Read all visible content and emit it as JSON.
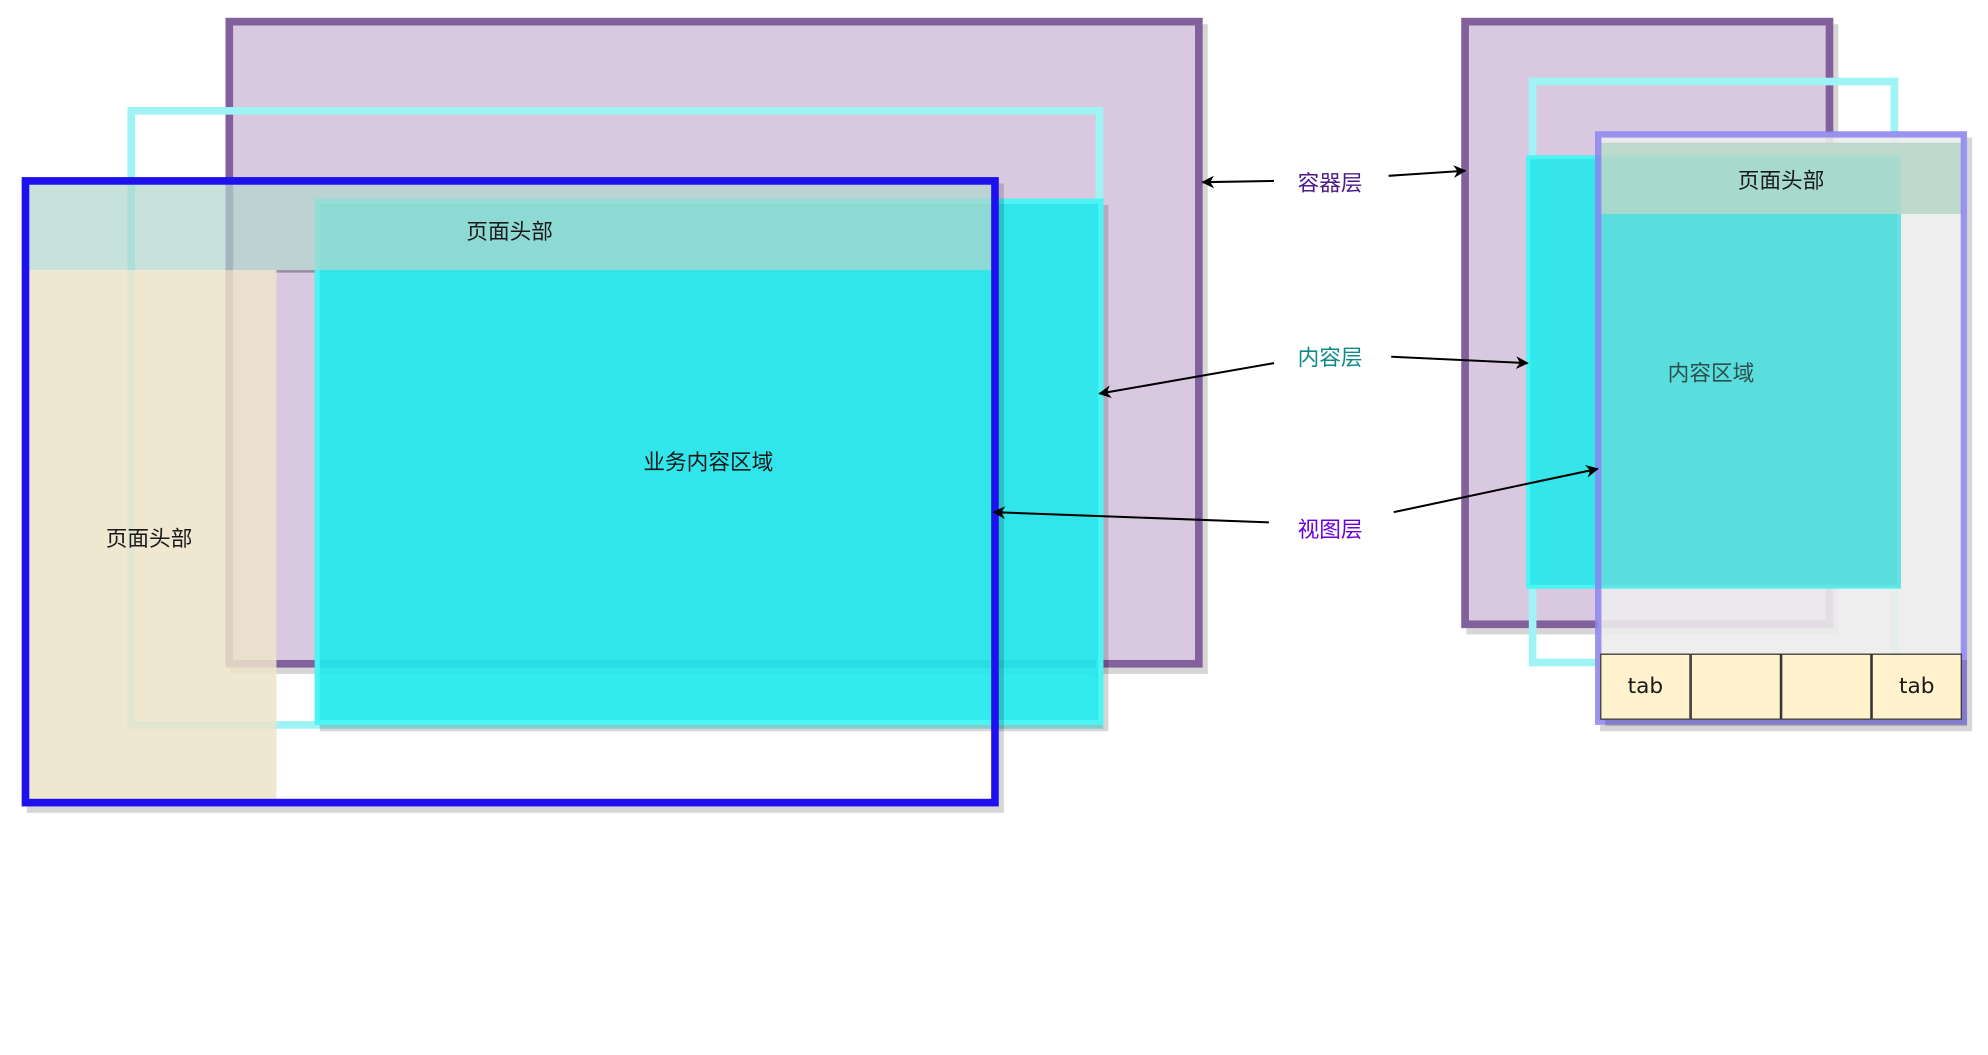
{
  "left_diagram": {
    "header_label": "页面头部",
    "side_label": "页面头部",
    "content_label": "业务内容区域"
  },
  "annotations": {
    "container_layer": "容器层",
    "content_layer": "内容层",
    "view_layer": "视图层"
  },
  "right_diagram": {
    "header_label": "页面头部",
    "content_label": "内容区域",
    "tabs": [
      "tab",
      "",
      "",
      "tab"
    ]
  },
  "colors": {
    "container_fill": "#d9c9e0",
    "container_border": "#82609c",
    "content_fill": "#22e8ea",
    "content_border": "#9ef3f4",
    "view_border": "#1f10ee",
    "header_fill": "#b7d7d1",
    "sidebar_fill": "#ede3c9",
    "tab_fill": "#fff2cc",
    "container_text": "#4b1a86",
    "content_text": "#0e8a8a",
    "view_text": "#6a00d9"
  }
}
